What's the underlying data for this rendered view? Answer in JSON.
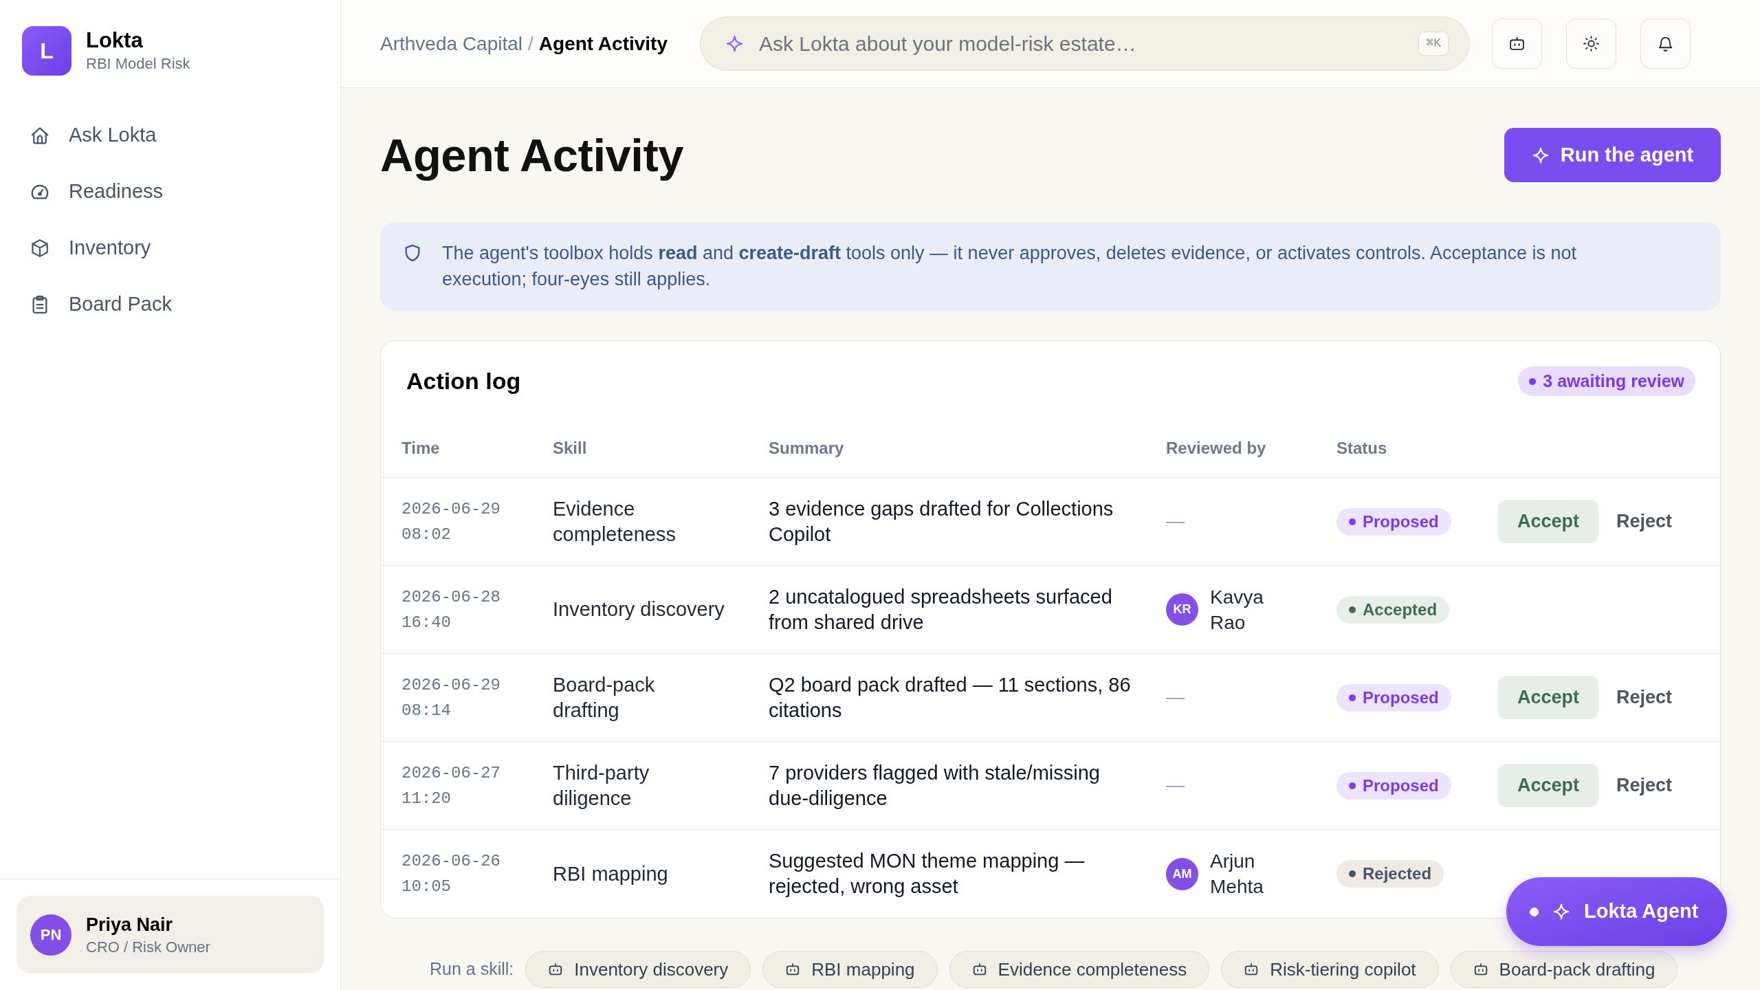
{
  "sidebar": {
    "brand": {
      "logo": "L",
      "name": "Lokta",
      "subtitle": "RBI Model Risk"
    },
    "nav": [
      {
        "label": "Ask Lokta",
        "selected": false
      },
      {
        "label": "Readiness",
        "selected": false
      },
      {
        "label": "Inventory",
        "selected": false
      },
      {
        "label": "Board Pack",
        "selected": false
      }
    ],
    "user": {
      "initials": "PN",
      "name": "Priya Nair",
      "role": "CRO / Risk Owner"
    }
  },
  "header": {
    "breadcrumb": [
      {
        "label": "Arthveda Capital",
        "current": false
      },
      {
        "label": "Agent Activity",
        "current": true
      }
    ],
    "separator": "/",
    "search": {
      "placeholder": "Ask Lokta about your model-risk estate…",
      "shortcut": "⌘K"
    }
  },
  "page": {
    "title": "Agent Activity",
    "run_button": "Run the agent"
  },
  "notice": {
    "text": "The agent's toolbox holds **read** and **create-draft** tools only — it never approves, deletes evidence, or activates controls. Acceptance is not execution; four-eyes still applies."
  },
  "action_log": {
    "title": "Action log",
    "badge": "3 awaiting review",
    "columns": [
      "Time",
      "Skill",
      "Summary",
      "Reviewed by",
      "Status"
    ],
    "rows": [
      {
        "time": "2026-06-29 08:02",
        "skill": "Evidence completeness",
        "summary": "3 evidence gaps drafted for Collections Copilot",
        "reviewed_by": "—",
        "status": {
          "kind": "proposed",
          "label": "Proposed"
        },
        "actions": [
          {
            "kind": "accept",
            "label": "Accept"
          },
          {
            "kind": "reject",
            "label": "Reject"
          }
        ]
      },
      {
        "time": "2026-06-28 16:40",
        "skill": "Inventory discovery",
        "summary": "2 uncatalogued spreadsheets surfaced from shared drive",
        "reviewer": {
          "initials": "KR",
          "name": "Kavya Rao"
        },
        "status": {
          "kind": "accepted",
          "label": "Accepted"
        }
      },
      {
        "time": "2026-06-29 08:14",
        "skill": "Board-pack drafting",
        "summary": "Q2 board pack drafted — 11 sections, 86 citations",
        "reviewed_by": "—",
        "status": {
          "kind": "proposed",
          "label": "Proposed"
        },
        "actions": [
          {
            "kind": "accept",
            "label": "Accept"
          },
          {
            "kind": "reject",
            "label": "Reject"
          }
        ]
      },
      {
        "time": "2026-06-27 11:20",
        "skill": "Third-party diligence",
        "summary": "7 providers flagged with stale/missing due-diligence",
        "reviewed_by": "—",
        "status": {
          "kind": "proposed",
          "label": "Proposed"
        },
        "actions": [
          {
            "kind": "accept",
            "label": "Accept"
          },
          {
            "kind": "reject",
            "label": "Reject"
          }
        ]
      },
      {
        "time": "2026-06-26 10:05",
        "skill": "RBI mapping",
        "summary": "Suggested MON theme mapping — rejected, wrong asset",
        "reviewer": {
          "initials": "AM",
          "name": "Arjun Mehta"
        },
        "status": {
          "kind": "rejected",
          "label": "Rejected"
        }
      }
    ]
  },
  "skill_bar": {
    "label": "Run a skill:",
    "skills": [
      "Inventory discovery",
      "RBI mapping",
      "Evidence completeness",
      "Risk-tiering copilot",
      "Board-pack drafting"
    ]
  },
  "agent_button": {
    "label": "Lokta Agent"
  }
}
